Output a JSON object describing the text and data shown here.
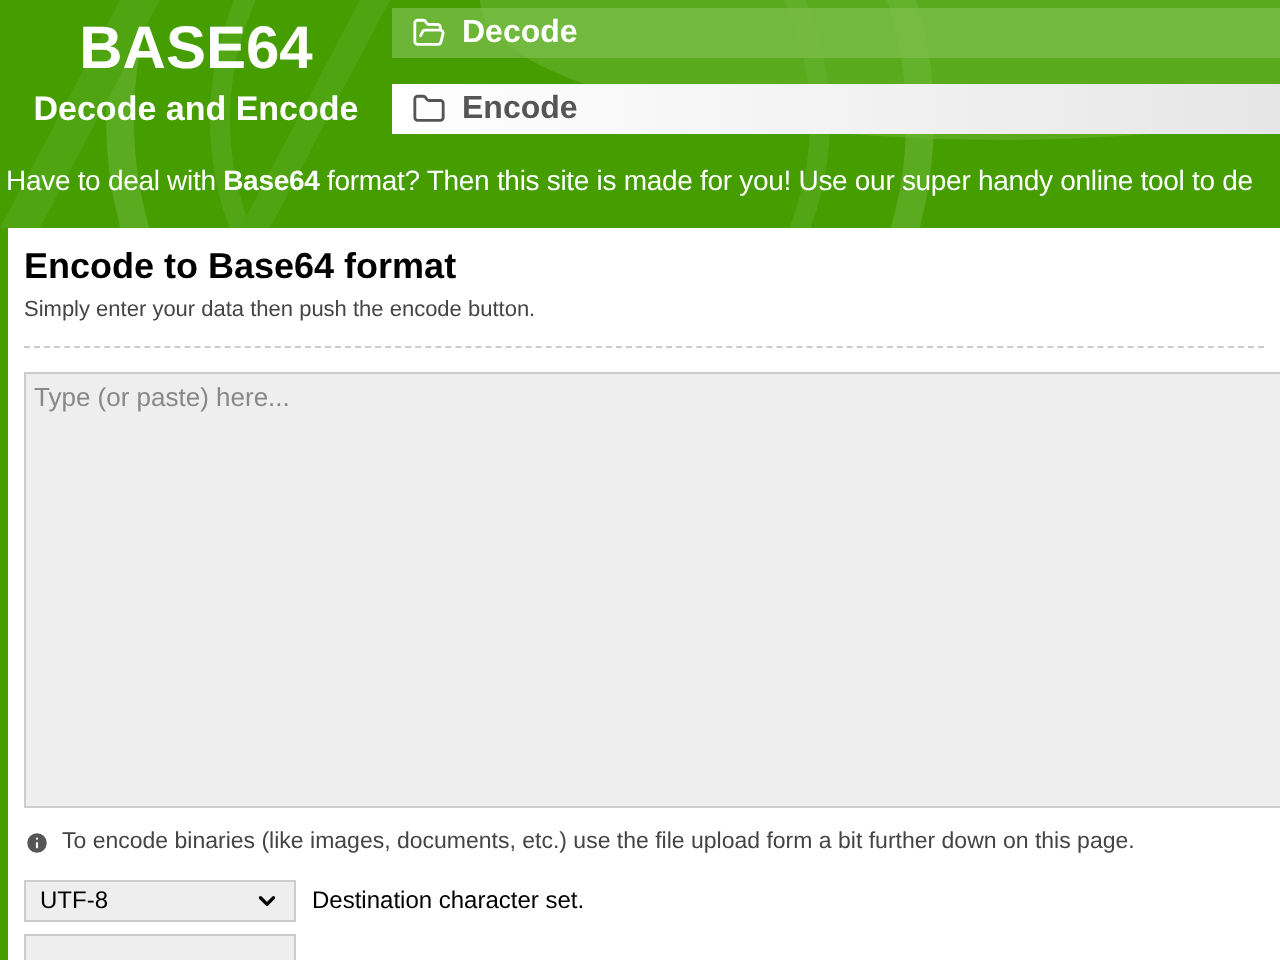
{
  "logo": {
    "title": "BASE64",
    "subtitle": "Decode and Encode"
  },
  "tabs": [
    {
      "label": "Decode",
      "selected": false
    },
    {
      "label": "Encode",
      "selected": true
    }
  ],
  "intro": "Have to deal with **Base64** format? Then this site is made for you! Use our super handy online tool to de",
  "panel": {
    "title": "Encode to Base64 format",
    "subtitle": "Simply enter your data then push the encode button.",
    "input": {
      "placeholder": "Type (or paste) here..."
    },
    "note": "To encode binaries (like images, documents, etc.) use the file upload form a bit further down on this page.",
    "charset": {
      "value": "UTF-8",
      "label": "Destination character set."
    }
  }
}
